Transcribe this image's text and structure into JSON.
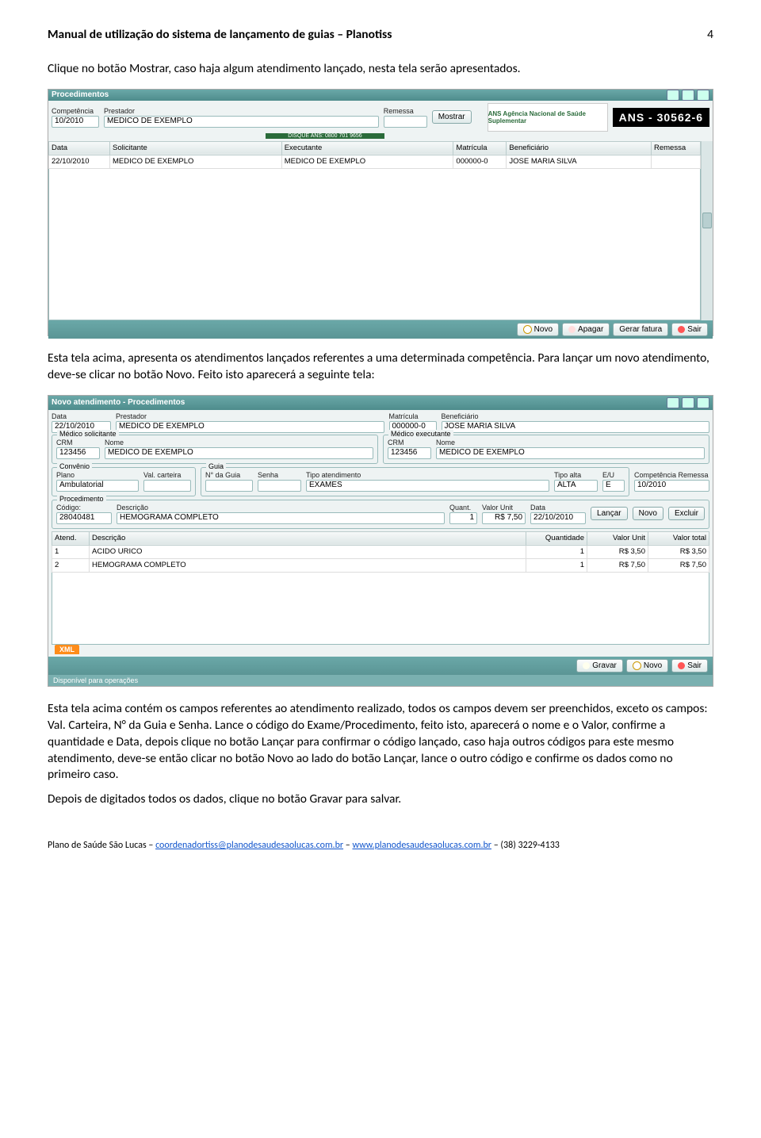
{
  "header": {
    "title": "Manual de utilização do sistema de lançamento de guias – Planotiss",
    "page": "4"
  },
  "p1": "Clique no botão Mostrar, caso haja algum atendimento lançado, nesta tela serão apresentados.",
  "p2": "Esta tela acima, apresenta os atendimentos lançados referentes a uma determinada competência. Para lançar um novo atendimento, deve-se clicar no botão Novo. Feito isto aparecerá a seguinte tela:",
  "p3": "Esta tela acima contém os campos referentes ao atendimento realizado, todos os campos devem ser preenchidos, exceto os campos: Val. Carteira, N° da Guia e Senha. Lance o código do Exame/Procedimento, feito isto, aparecerá o nome e o Valor, confirme a quantidade e Data, depois clique no botão Lançar para confirmar o código lançado, caso haja outros códigos para este mesmo atendimento, deve-se então clicar no botão Novo ao lado do botão Lançar, lance o outro código e confirme os dados como no primeiro caso.",
  "p4": "Depois de digitados todos os dados, clique no botão Gravar para salvar.",
  "footer": {
    "org": "Plano de Saúde São Lucas – ",
    "email": "coordenadortiss@planodesaudesaolucas.com.br",
    "sep": " – ",
    "site": "www.planodesaudesaolucas.com.br",
    "phone": " – (38) 3229-4133"
  },
  "shot1": {
    "title": "Procedimentos",
    "labels": {
      "comp": "Competência",
      "prest": "Prestador",
      "rem": "Remessa"
    },
    "comp": "10/2010",
    "prest": "MEDICO DE EXEMPLO",
    "btn_mostrar": "Mostrar",
    "ans_text": "ANS Agência Nacional de Saúde Suplementar",
    "ans_sub": "DISQUE ANS: 0800 701 9656",
    "ans_num": "ANS - 30562-6",
    "cols": [
      "Data",
      "Solicitante",
      "Executante",
      "Matrícula",
      "Beneficiário",
      "Remessa"
    ],
    "row": [
      "22/10/2010",
      "MEDICO DE EXEMPLO",
      "MEDICO DE EXEMPLO",
      "000000-0",
      "JOSE MARIA SILVA",
      ""
    ],
    "btns": {
      "novo": "Novo",
      "apagar": "Apagar",
      "gerar": "Gerar fatura",
      "sair": "Sair"
    }
  },
  "shot2": {
    "title": "Novo atendimento - Procedimentos",
    "top": {
      "lbl_data": "Data",
      "data": "22/10/2010",
      "lbl_prest": "Prestador",
      "prest": "MEDICO DE EXEMPLO",
      "lbl_matr": "Matrícula",
      "matr": "000000-0",
      "lbl_ben": "Beneficiário",
      "ben": "JOSE MARIA SILVA"
    },
    "solic": {
      "leg": "Médico solicitante",
      "lbl_crm": "CRM",
      "crm": "123456",
      "lbl_nome": "Nome",
      "nome": "MEDICO DE EXEMPLO"
    },
    "exec": {
      "leg": "Médico executante",
      "lbl_crm": "CRM",
      "crm": "123456",
      "lbl_nome": "Nome",
      "nome": "MEDICO DE EXEMPLO"
    },
    "conv": {
      "leg": "Convênio",
      "lbl_plano": "Plano",
      "plano": "Ambulatorial",
      "lbl_val": "Val. carteira"
    },
    "guia": {
      "leg": "Guia",
      "lbl_num": "N° da Guia",
      "lbl_senha": "Senha",
      "lbl_tipo": "Tipo atendimento",
      "tipo": "EXAMES",
      "lbl_alta": "Tipo alta",
      "alta": "ALTA",
      "lbl_eu": "E/U",
      "eu": "E"
    },
    "remcomp": {
      "lbl": "Competência Remessa",
      "val": "10/2010"
    },
    "proc": {
      "leg": "Procedimento",
      "lbl_cod": "Código:",
      "cod": "28040481",
      "lbl_desc": "Descrição",
      "desc": "HEMOGRAMA COMPLETO",
      "lbl_q": "Quant.",
      "q": "1",
      "lbl_vu": "Valor Unit",
      "vu": "R$ 7,50",
      "lbl_data": "Data",
      "data": "22/10/2010",
      "btn_lancar": "Lançar",
      "btn_novo": "Novo",
      "btn_excluir": "Excluir"
    },
    "tbl_cols": [
      "Atend.",
      "Descrição",
      "Quantidade",
      "Valor Unit",
      "Valor total"
    ],
    "tbl_rows": [
      [
        "1",
        "ACIDO URICO",
        "1",
        "R$ 3,50",
        "R$ 3,50"
      ],
      [
        "2",
        "HEMOGRAMA COMPLETO",
        "1",
        "R$ 7,50",
        "R$ 7,50"
      ]
    ],
    "xml": "XML",
    "status": "Disponível para operações",
    "btns": {
      "gravar": "Gravar",
      "novo": "Novo",
      "sair": "Sair"
    }
  }
}
